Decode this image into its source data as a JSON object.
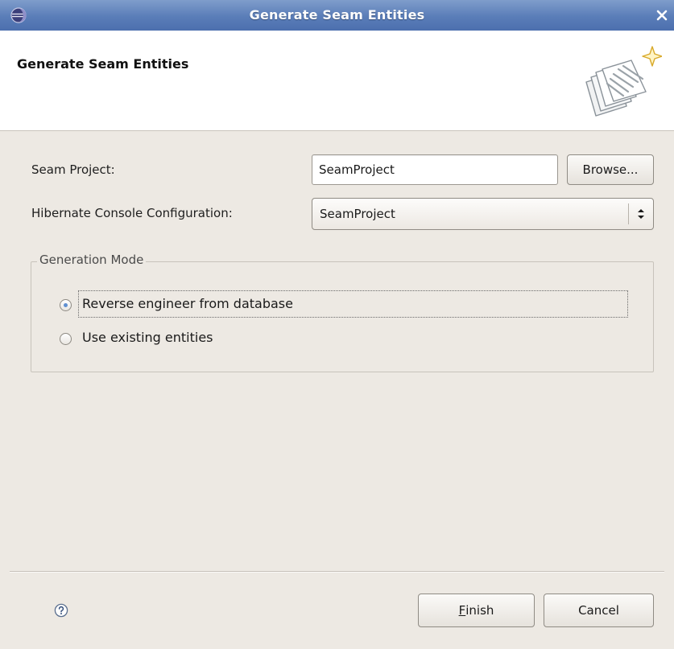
{
  "window": {
    "title": "Generate Seam Entities",
    "icons": {
      "app": "eclipse-icon",
      "close": "close-icon"
    }
  },
  "banner": {
    "title": "Generate Seam Entities",
    "image_icon": "seam-wizard-banner-icon"
  },
  "form": {
    "project_label": "Seam Project:",
    "project_value": "SeamProject",
    "browse_label": "Browse...",
    "console_label": "Hibernate Console Configuration:",
    "console_value": "SeamProject",
    "console_icon": "dropdown-arrows-icon"
  },
  "generation_mode": {
    "legend": "Generation Mode",
    "options": [
      {
        "label": "Reverse engineer from database",
        "selected": true
      },
      {
        "label": "Use existing entities",
        "selected": false
      }
    ]
  },
  "footer": {
    "help_icon": "help-icon",
    "finish_mnemonic": "F",
    "finish_rest": "inish",
    "cancel_label": "Cancel"
  },
  "colors": {
    "titlebar": "#5a7db8",
    "dialog_bg": "#ede9e3",
    "radio_dot": "#5f8fd1"
  }
}
